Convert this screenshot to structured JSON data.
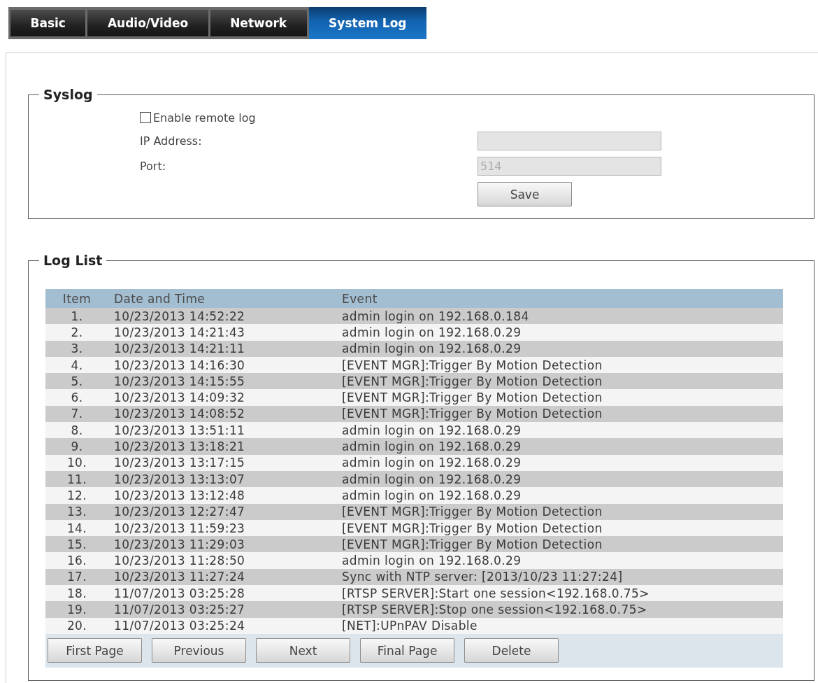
{
  "tabs": [
    {
      "label": "Basic",
      "selected": false
    },
    {
      "label": "Audio/Video",
      "selected": false
    },
    {
      "label": "Network",
      "selected": false
    },
    {
      "label": "System Log",
      "selected": true
    }
  ],
  "syslog": {
    "title": "Syslog",
    "enable_remote_log": {
      "label": "Enable remote log",
      "checked": false
    },
    "ip_address": {
      "label": "IP Address:",
      "disabled": true
    },
    "port": {
      "label": "Port:",
      "value": "514",
      "disabled": true
    },
    "save_button": "Save"
  },
  "log_list": {
    "title": "Log List",
    "columns": [
      "Item",
      "Date and Time",
      "Event"
    ],
    "rows": [
      {
        "item": "1.",
        "date_time": "10/23/2013 14:52:22",
        "event": "admin login on 192.168.0.184"
      },
      {
        "item": "2.",
        "date_time": "10/23/2013 14:21:43",
        "event": "admin login on 192.168.0.29"
      },
      {
        "item": "3.",
        "date_time": "10/23/2013 14:21:11",
        "event": "admin login on 192.168.0.29"
      },
      {
        "item": "4.",
        "date_time": "10/23/2013 14:16:30",
        "event": "[EVENT MGR]:Trigger By Motion Detection"
      },
      {
        "item": "5.",
        "date_time": "10/23/2013 14:15:55",
        "event": "[EVENT MGR]:Trigger By Motion Detection"
      },
      {
        "item": "6.",
        "date_time": "10/23/2013 14:09:32",
        "event": "[EVENT MGR]:Trigger By Motion Detection"
      },
      {
        "item": "7.",
        "date_time": "10/23/2013 14:08:52",
        "event": "[EVENT MGR]:Trigger By Motion Detection"
      },
      {
        "item": "8.",
        "date_time": "10/23/2013 13:51:11",
        "event": "admin login on 192.168.0.29"
      },
      {
        "item": "9.",
        "date_time": "10/23/2013 13:18:21",
        "event": "admin login on 192.168.0.29"
      },
      {
        "item": "10.",
        "date_time": "10/23/2013 13:17:15",
        "event": "admin login on 192.168.0.29"
      },
      {
        "item": "11.",
        "date_time": "10/23/2013 13:13:07",
        "event": "admin login on 192.168.0.29"
      },
      {
        "item": "12.",
        "date_time": "10/23/2013 13:12:48",
        "event": "admin login on 192.168.0.29"
      },
      {
        "item": "13.",
        "date_time": "10/23/2013 12:27:47",
        "event": "[EVENT MGR]:Trigger By Motion Detection"
      },
      {
        "item": "14.",
        "date_time": "10/23/2013 11:59:23",
        "event": "[EVENT MGR]:Trigger By Motion Detection"
      },
      {
        "item": "15.",
        "date_time": "10/23/2013 11:29:03",
        "event": "[EVENT MGR]:Trigger By Motion Detection"
      },
      {
        "item": "16.",
        "date_time": "10/23/2013 11:28:50",
        "event": "admin login on 192.168.0.29"
      },
      {
        "item": "17.",
        "date_time": "10/23/2013 11:27:24",
        "event": "Sync with NTP server: [2013/10/23 11:27:24]"
      },
      {
        "item": "18.",
        "date_time": "11/07/2013 03:25:28",
        "event": "[RTSP SERVER]:Start one session<192.168.0.75>"
      },
      {
        "item": "19.",
        "date_time": "11/07/2013 03:25:27",
        "event": "[RTSP SERVER]:Stop one session<192.168.0.75>"
      },
      {
        "item": "20.",
        "date_time": "11/07/2013 03:25:24",
        "event": "[NET]:UPnPAV Disable"
      }
    ],
    "buttons": [
      "First Page",
      "Previous",
      "Next",
      "Final Page",
      "Delete"
    ]
  }
}
